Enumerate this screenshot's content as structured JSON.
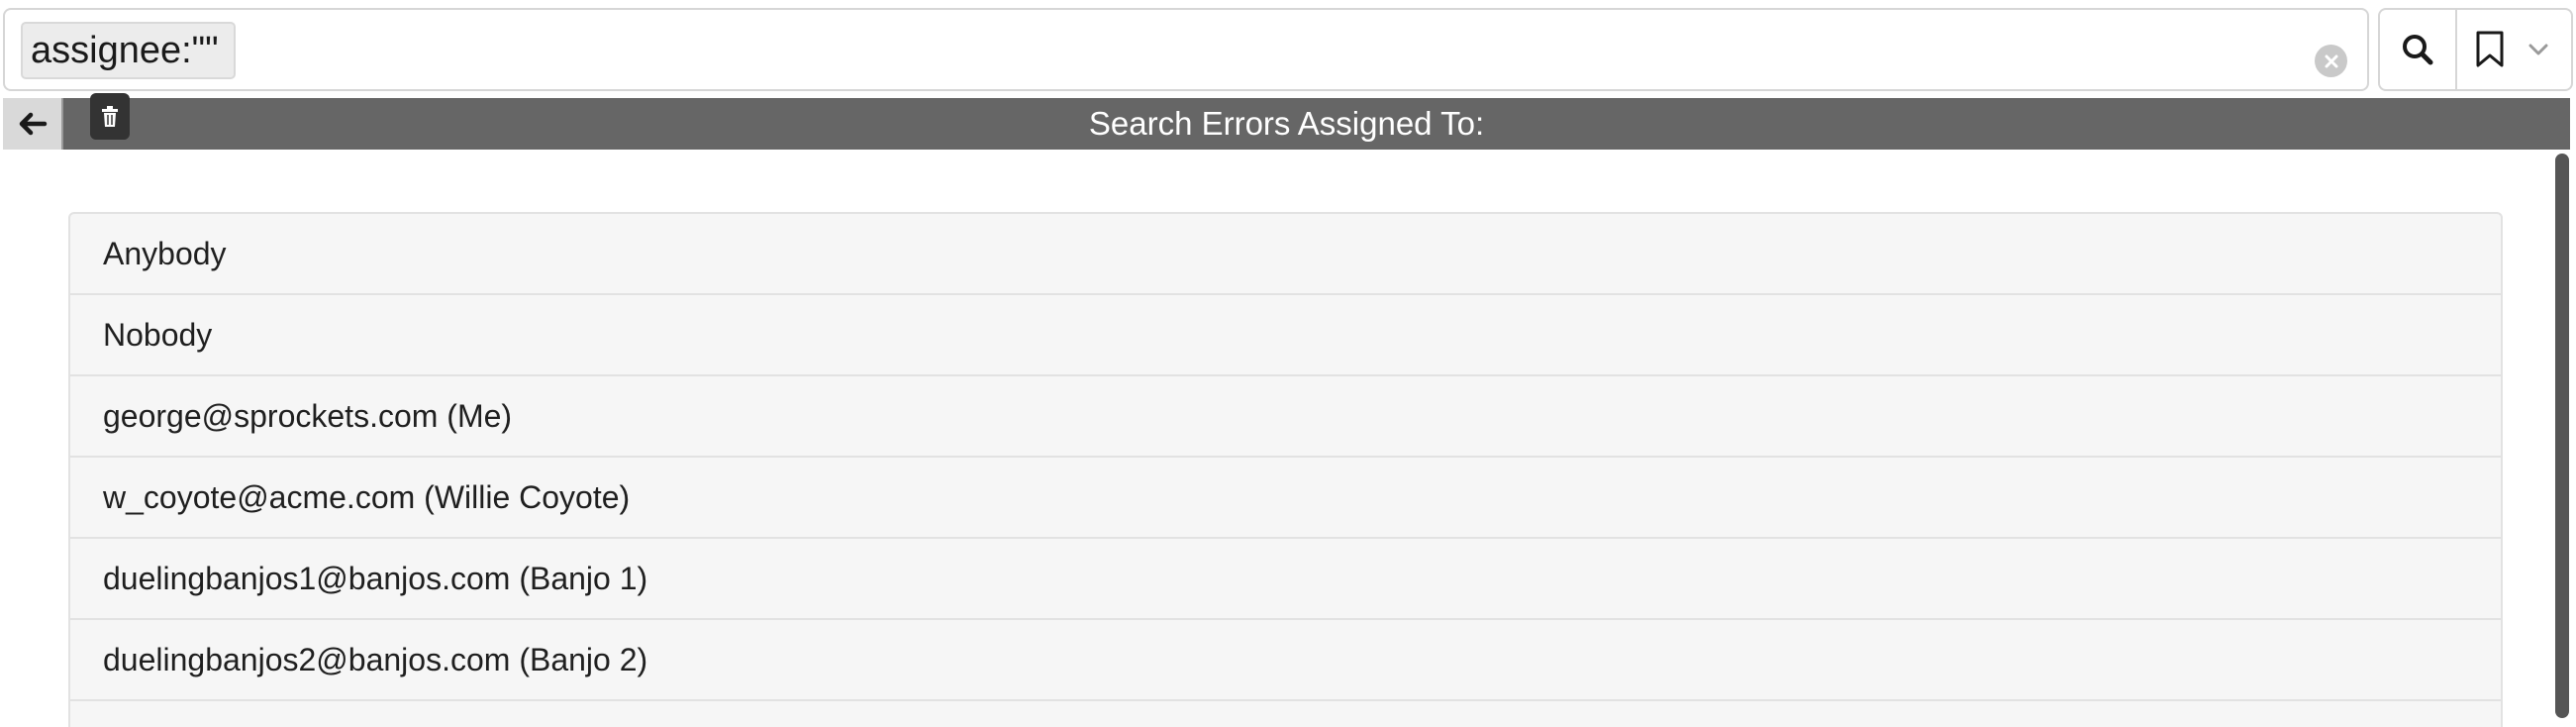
{
  "search": {
    "query_token": "assignee:\"\"",
    "placeholder": ""
  },
  "header": {
    "title": "Search Errors Assigned To:"
  },
  "list": {
    "items": [
      {
        "label": "Anybody"
      },
      {
        "label": "Nobody"
      },
      {
        "label": "george@sprockets.com (Me)"
      },
      {
        "label": "w_coyote@acme.com (Willie Coyote)"
      },
      {
        "label": "duelingbanjos1@banjos.com (Banjo 1)"
      },
      {
        "label": "duelingbanjos2@banjos.com (Banjo 2)"
      }
    ]
  },
  "icons": {
    "token_delete": "trash-icon",
    "clear": "clear-circle-icon",
    "search": "search-icon",
    "bookmark": "bookmark-icon",
    "dropdown": "chevron-down-icon",
    "back": "arrow-left-icon"
  },
  "colors": {
    "header_bg": "#666666",
    "header_text": "#ffffff",
    "list_bg": "#f6f6f6",
    "token_bg": "#ececec"
  }
}
